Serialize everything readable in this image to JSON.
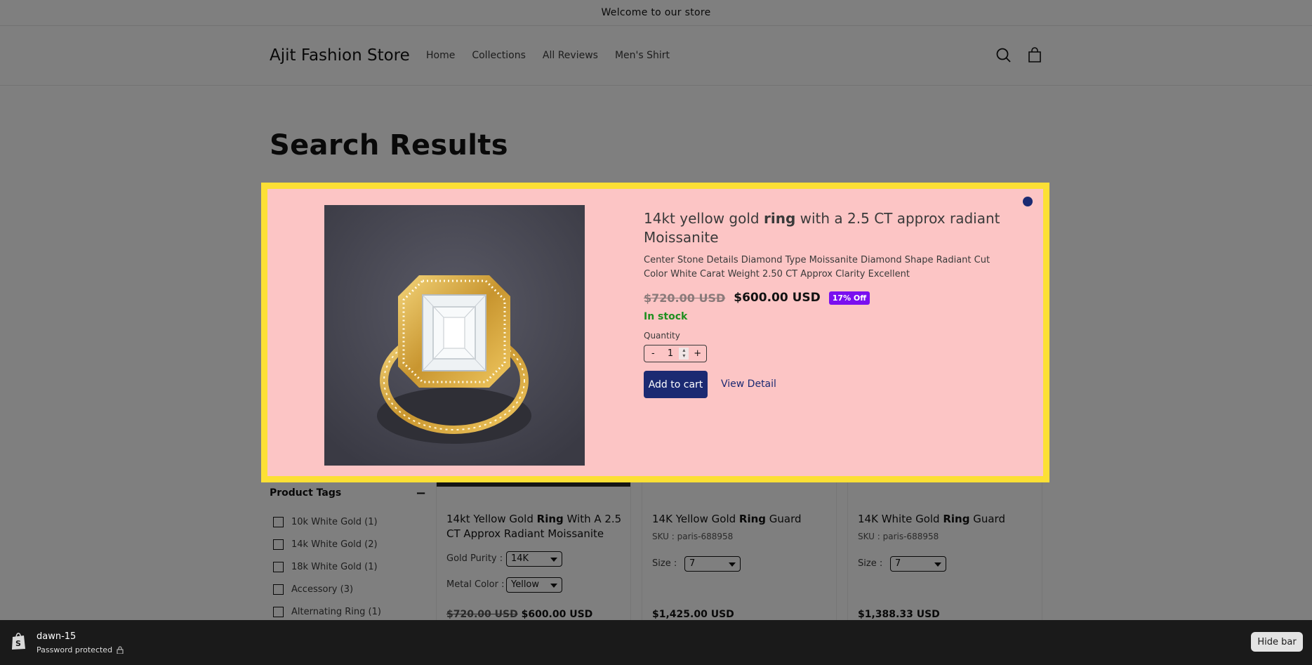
{
  "announcement": "Welcome to our store",
  "header": {
    "logo": "Ajit Fashion Store",
    "nav": [
      "Home",
      "Collections",
      "All Reviews",
      "Men's Shirt"
    ],
    "search_icon": "search-icon",
    "cart_icon": "cart-icon"
  },
  "page_title": "Search Results",
  "sidebar": {
    "heading": "Product Tags",
    "toggle": "−",
    "tags": [
      "10k White Gold (1)",
      "14k White Gold (2)",
      "18k White Gold (1)",
      "Accessory (3)",
      "Alternating Ring (1)"
    ]
  },
  "products": [
    {
      "title_pre": "14kt Yellow Gold ",
      "title_bold": "Ring",
      "title_post": " With A 2.5 CT Approx Radiant Moissanite",
      "opt1_label": "Gold Purity :",
      "opt1_value": "14K",
      "opt2_label": "Metal Color :",
      "opt2_value": "Yellow",
      "old_price": "$720.00 USD",
      "price": "$600.00 USD"
    },
    {
      "title_pre": "14K Yellow Gold ",
      "title_bold": "Ring",
      "title_post": " Guard",
      "sku": "SKU : paris-688958",
      "opt1_label": "Size :",
      "opt1_value": "7",
      "price": "$1,425.00 USD"
    },
    {
      "title_pre": "14K White Gold ",
      "title_bold": "Ring",
      "title_post": " Guard",
      "sku": "SKU : paris-688958",
      "opt1_label": "Size :",
      "opt1_value": "7",
      "price": "$1,388.33 USD"
    }
  ],
  "quickview": {
    "title_pre": "14kt yellow gold ",
    "title_bold": "ring",
    "title_post": " with a 2.5 CT approx radiant Moissanite",
    "description": "Center Stone Details Diamond Type Moissanite Diamond Shape Radiant Cut Color White Carat Weight 2.50 CT Approx Clarity Excellent",
    "old_price": "$720.00 USD",
    "price": "$600.00 USD",
    "badge": "17% Off",
    "stock": "In stock",
    "quantity_label": "Quantity",
    "qty_minus": "-",
    "qty_value": "1",
    "qty_plus": "+",
    "add_to_cart": "Add to cart",
    "view_detail": "View Detail",
    "close_icon": "close-icon",
    "colors": {
      "background": "#fcc5c5",
      "border": "#fce035",
      "button": "#1b2a72",
      "badge": "#7a0ff0",
      "stock": "#1f8f1f"
    }
  },
  "admin_bar": {
    "store": "dawn-15",
    "status": "Password protected",
    "hide": "Hide bar"
  }
}
